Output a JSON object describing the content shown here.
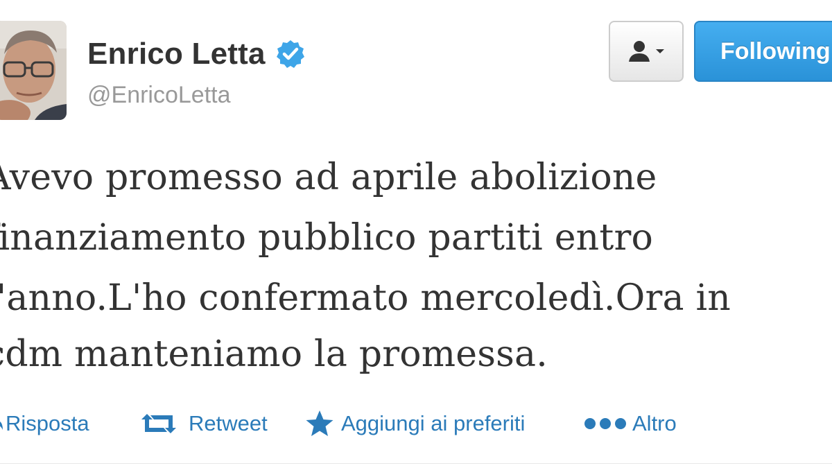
{
  "profile": {
    "display_name": "Enrico Letta",
    "handle": "@EnricoLetta",
    "verified": true
  },
  "buttons": {
    "follow_label": "Following",
    "user_menu_icon": "user-dropdown-icon"
  },
  "tweet": {
    "lines": [
      "Avevo promesso ad aprile abolizione",
      "finanziamento pubblico partiti entro",
      "l'anno.L'ho confermato mercoledì.Ora in",
      "cdm manteniamo la promessa."
    ]
  },
  "actions": {
    "reply_label": "Risposta",
    "retweet_label": "Retweet",
    "favorite_label": "Aggiungi ai preferiti",
    "more_label": "Altro"
  },
  "colors": {
    "accent": "#2b7bb9",
    "verified": "#3ea5e8",
    "follow_button": "#3a9fe3",
    "text": "#333333",
    "muted": "#999999"
  }
}
